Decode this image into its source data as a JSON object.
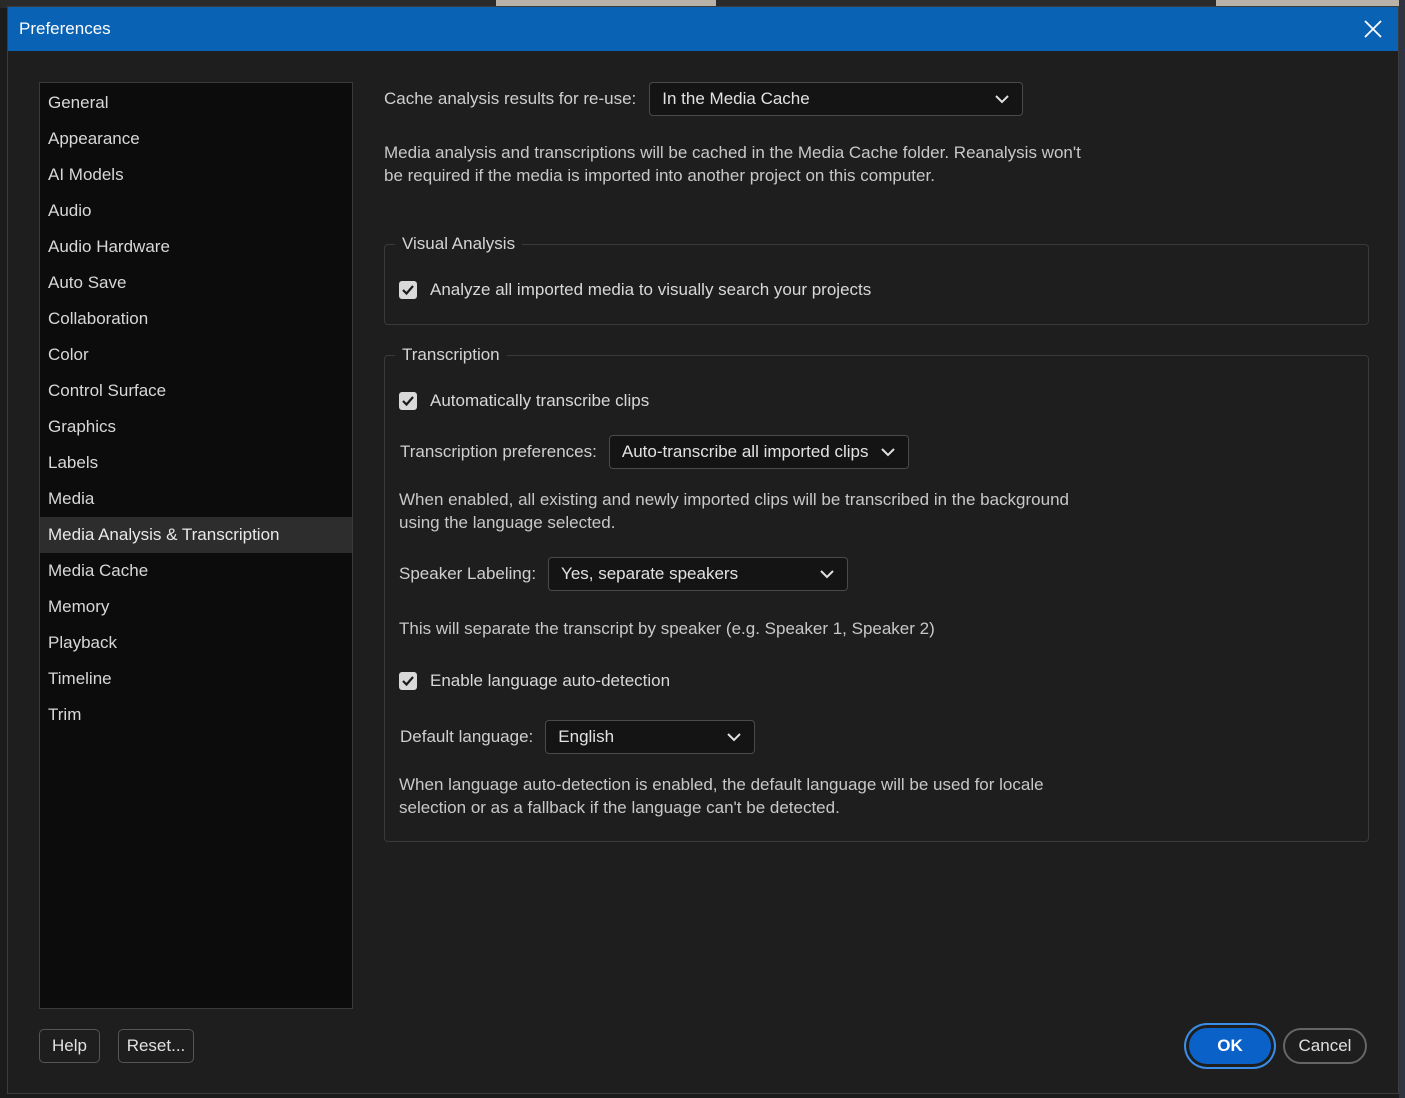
{
  "window": {
    "title": "Preferences"
  },
  "sidebar": {
    "items": [
      {
        "label": "General"
      },
      {
        "label": "Appearance"
      },
      {
        "label": "AI Models"
      },
      {
        "label": "Audio"
      },
      {
        "label": "Audio Hardware"
      },
      {
        "label": "Auto Save"
      },
      {
        "label": "Collaboration"
      },
      {
        "label": "Color"
      },
      {
        "label": "Control Surface"
      },
      {
        "label": "Graphics"
      },
      {
        "label": "Labels"
      },
      {
        "label": "Media"
      },
      {
        "label": "Media Analysis & Transcription"
      },
      {
        "label": "Media Cache"
      },
      {
        "label": "Memory"
      },
      {
        "label": "Playback"
      },
      {
        "label": "Timeline"
      },
      {
        "label": "Trim"
      }
    ],
    "active_index": 12
  },
  "cache": {
    "label": "Cache analysis results for re-use:",
    "selected": "In the Media Cache",
    "description_line1": "Media analysis and transcriptions will be cached in the Media Cache folder. Reanalysis won't",
    "description_line2": "be required if the media is imported into another project on this computer."
  },
  "visual_analysis": {
    "legend": "Visual Analysis",
    "analyze_label": "Analyze all imported media to visually search your projects",
    "analyze_checked": true
  },
  "transcription": {
    "legend": "Transcription",
    "auto_label": "Automatically transcribe clips",
    "auto_checked": true,
    "prefs_label": "Transcription preferences:",
    "prefs_selected": "Auto-transcribe all imported clips",
    "prefs_desc_line1": "When enabled, all existing and newly imported clips will be transcribed in the background",
    "prefs_desc_line2": "using the language selected.",
    "speaker_label": "Speaker Labeling:",
    "speaker_selected": "Yes, separate speakers",
    "speaker_desc": "This will separate the transcript by speaker (e.g. Speaker 1, Speaker 2)",
    "autodetect_label": "Enable language auto-detection",
    "autodetect_checked": true,
    "lang_label": "Default language:",
    "lang_selected": "English",
    "lang_desc_line1": "When language auto-detection is enabled, the default language will be used for locale",
    "lang_desc_line2": "selection or as a fallback if the language can't be detected."
  },
  "footer": {
    "help": "Help",
    "reset": "Reset...",
    "ok": "OK",
    "cancel": "Cancel"
  },
  "colors": {
    "titlebar": "#0a62b5",
    "ok_button": "#0a62c9",
    "background": "#1e1e1e",
    "sidebar_bg": "#0c0c0c"
  }
}
